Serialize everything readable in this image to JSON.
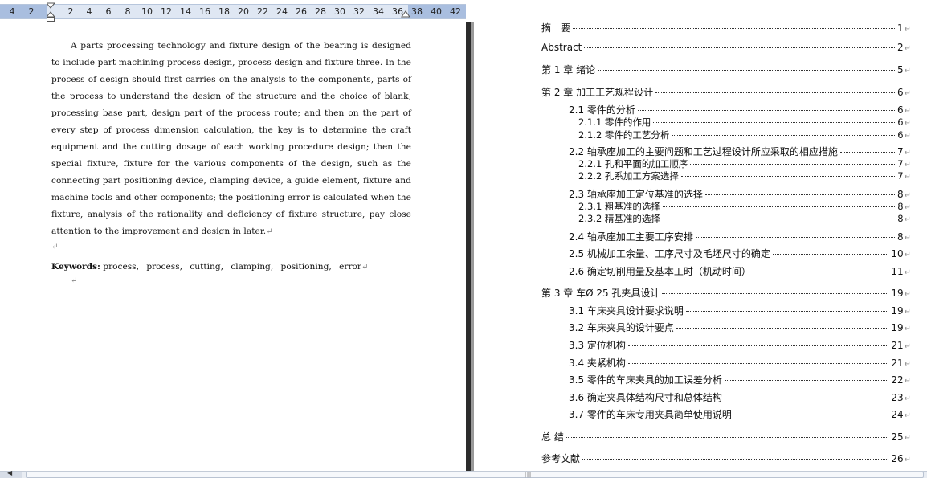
{
  "ruler": {
    "left_numbers": [
      "4",
      "2"
    ],
    "right_numbers": [
      "2",
      "4",
      "6",
      "8",
      "10",
      "12",
      "14",
      "16",
      "18",
      "20",
      "22",
      "24",
      "26",
      "28",
      "30",
      "32",
      "34",
      "36"
    ],
    "margin_numbers": [
      "38",
      "40",
      "42"
    ]
  },
  "abstract": {
    "body": "A parts processing technology and fixture design of the bearing is designed to include part machining process design, process design and fixture three. In the process of design should first carries on the analysis to the components, parts of the process to understand the design of the structure and the choice of blank, processing base part, design part of the process route; and then on the part of every step of process dimension calculation, the key is to determine the craft equipment and the cutting dosage of each working procedure design; then the special fixture, fixture for the various components of the design, such as the connecting part positioning device, clamping device, a guide element, fixture and machine tools and other components; the positioning error is calculated when the fixture, analysis of the rationality and deficiency of fixture structure, pay close attention to the improvement and design in later.",
    "keywords_label": "Keywords:",
    "keywords": "process, process, cutting, clamping, positioning, error",
    "para_mark": "↵"
  },
  "toc": [
    {
      "title": "摘　要",
      "page": "1"
    },
    {
      "title": "Abstract",
      "page": "2"
    },
    {
      "title": "第 1 章  绪论",
      "page": "5"
    },
    {
      "title": "第 2 章  加工工艺规程设计",
      "page": "6"
    },
    {
      "title": "2.1  零件的分析",
      "page": "6"
    },
    {
      "title": "2.1.1  零件的作用",
      "page": "6"
    },
    {
      "title": "2.1.2  零件的工艺分析",
      "page": "6"
    },
    {
      "title": "2.2  轴承座加工的主要问题和工艺过程设计所应采取的相应措施",
      "page": "7"
    },
    {
      "title": "2.2.1  孔和平面的加工顺序",
      "page": "7"
    },
    {
      "title": "2.2.2  孔系加工方案选择",
      "page": "7"
    },
    {
      "title": "2.3  轴承座加工定位基准的选择",
      "page": "8"
    },
    {
      "title": "2.3.1  粗基准的选择",
      "page": "8"
    },
    {
      "title": "2.3.2  精基准的选择",
      "page": "8"
    },
    {
      "title": "2.4  轴承座加工主要工序安排",
      "page": "8"
    },
    {
      "title": "2.5  机械加工余量、工序尺寸及毛坯尺寸的确定",
      "page": "10"
    },
    {
      "title": "2.6 确定切削用量及基本工时（机动时间）",
      "page": "11"
    },
    {
      "title": "第 3 章    车Ø 25 孔夹具设计",
      "page": "19"
    },
    {
      "title": "3.1  车床夹具设计要求说明",
      "page": "19"
    },
    {
      "title": "3.2 车床夹具的设计要点",
      "page": "19"
    },
    {
      "title": "3.3  定位机构",
      "page": "21"
    },
    {
      "title": "3.4 夹紧机构",
      "page": "21"
    },
    {
      "title": "3.5 零件的车床夹具的加工误差分析",
      "page": "22"
    },
    {
      "title": "3.6  确定夹具体结构尺寸和总体结构",
      "page": "23"
    },
    {
      "title": "3.7  零件的车床专用夹具简单使用说明",
      "page": "24"
    },
    {
      "title": "总  结",
      "page": "25"
    },
    {
      "title": "参考文献",
      "page": "26"
    }
  ],
  "scrollbar": {
    "left_arrow": "◀",
    "grip": "|||"
  }
}
